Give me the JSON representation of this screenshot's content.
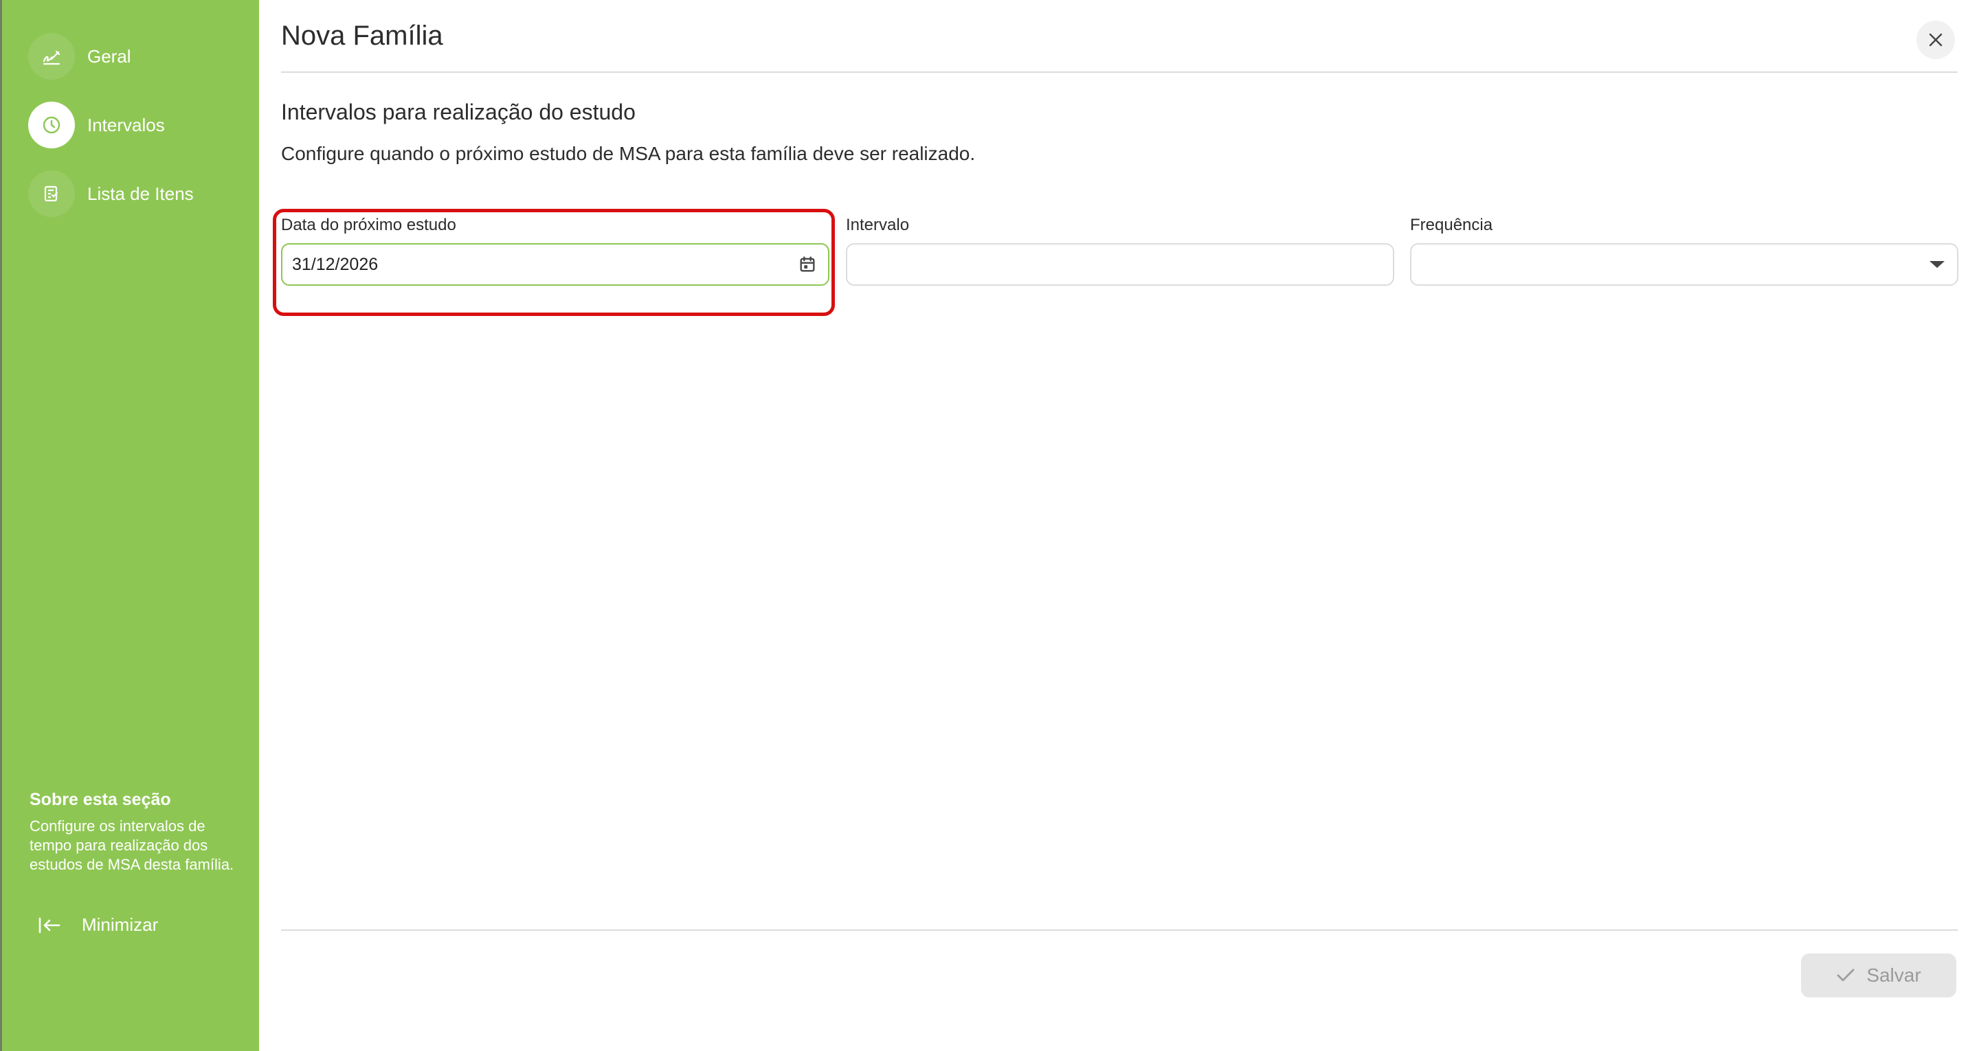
{
  "sidebar": {
    "items": [
      {
        "label": "Geral",
        "icon": "signature-icon",
        "active": false
      },
      {
        "label": "Intervalos",
        "icon": "clock-icon",
        "active": true
      },
      {
        "label": "Lista de Itens",
        "icon": "list-icon",
        "active": false
      }
    ],
    "about": {
      "title": "Sobre esta seção",
      "text": "Configure os intervalos de tempo para realização dos estudos de MSA desta família."
    },
    "minimize_label": "Minimizar"
  },
  "header": {
    "title": "Nova Família"
  },
  "section": {
    "title": "Intervalos para realização do estudo",
    "description": "Configure quando o próximo estudo de MSA para esta família deve ser realizado."
  },
  "fields": {
    "next_study_date": {
      "label": "Data do próximo estudo",
      "value": "31/12/2026"
    },
    "interval": {
      "label": "Intervalo",
      "value": ""
    },
    "frequency": {
      "label": "Frequência",
      "value": ""
    }
  },
  "footer": {
    "save_label": "Salvar"
  },
  "colors": {
    "sidebar_bg": "#8ec653",
    "highlight": "#d80f0f",
    "focus_border": "#8ec653"
  }
}
